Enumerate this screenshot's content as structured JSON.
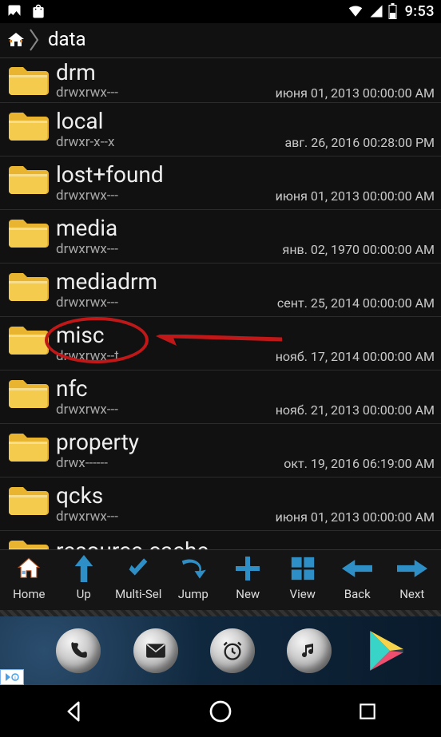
{
  "status": {
    "time": "9:53"
  },
  "breadcrumb": {
    "current": "data"
  },
  "files": [
    {
      "name": "drm",
      "perms": "drwxrwx---",
      "date": "июня 01, 2013 00:00:00 AM"
    },
    {
      "name": "local",
      "perms": "drwxr-x--x",
      "date": "авг. 26, 2016 00:28:00 PM"
    },
    {
      "name": "lost+found",
      "perms": "drwxrwx---",
      "date": "июня 01, 2013 00:00:00 AM"
    },
    {
      "name": "media",
      "perms": "drwxrwx---",
      "date": "янв. 02, 1970 00:00:00 AM"
    },
    {
      "name": "mediadrm",
      "perms": "drwxrwx---",
      "date": "сент. 25, 2014 00:00:00 AM"
    },
    {
      "name": "misc",
      "perms": "drwxrwx--t",
      "date": "нояб. 17, 2014 00:00:00 AM"
    },
    {
      "name": "nfc",
      "perms": "drwxrwx---",
      "date": "нояб. 21, 2013 00:00:00 AM"
    },
    {
      "name": "property",
      "perms": "drwx------",
      "date": "окт. 19, 2016 06:19:00 AM"
    },
    {
      "name": "qcks",
      "perms": "drwxrwx---",
      "date": "июня 01, 2013 00:00:00 AM"
    },
    {
      "name": "resource-cache",
      "perms": "",
      "date": ""
    }
  ],
  "annotation": {
    "highlighted_index": 5
  },
  "toolbar": [
    {
      "id": "home",
      "label": "Home"
    },
    {
      "id": "up",
      "label": "Up"
    },
    {
      "id": "multi",
      "label": "Multi-Sel"
    },
    {
      "id": "jump",
      "label": "Jump"
    },
    {
      "id": "new",
      "label": "New"
    },
    {
      "id": "view",
      "label": "View"
    },
    {
      "id": "back",
      "label": "Back"
    },
    {
      "id": "next",
      "label": "Next"
    }
  ],
  "colors": {
    "accent": "#2e8fc7",
    "annot": "#c01818"
  }
}
